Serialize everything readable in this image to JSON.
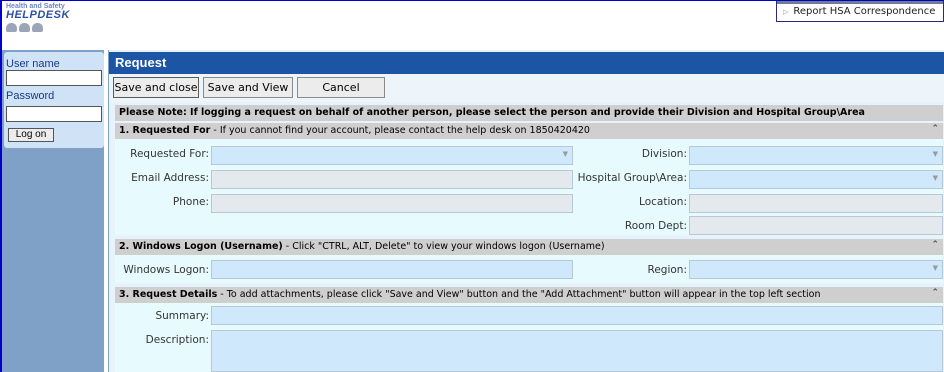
{
  "header": {
    "logo_line1": "Health and Safety",
    "logo_line2": "HELPDESK",
    "popup_item": "Report HSA Correspondence"
  },
  "login": {
    "username_label": "User name",
    "password_label": "Password",
    "username_value": "",
    "password_value": "",
    "logon_label": "Log on"
  },
  "request": {
    "title": "Request",
    "buttons": {
      "save_close": "Save and close",
      "save_view": "Save and View",
      "cancel": "Cancel"
    },
    "note": "Please Note: If logging a request on behalf of another person, please select the person and provide their Division and Hospital Group\\Area",
    "section1": {
      "heading_bold": "1. Requested For",
      "heading_rest": " - If you cannot find your account, please contact the help desk on 1850420420",
      "fields": {
        "requested_for": "Requested For:",
        "email": "Email Address:",
        "phone": "Phone:",
        "division": "Division:",
        "hospital_group": "Hospital Group\\Area:",
        "location": "Location:",
        "room_dept": "Room Dept:"
      }
    },
    "section2": {
      "heading_bold": "2. Windows Logon (Username)",
      "heading_rest": " - Click \"CTRL, ALT, Delete\" to view your windows logon (Username)",
      "fields": {
        "windows_logon": "Windows Logon:",
        "region": "Region:"
      }
    },
    "section3": {
      "heading_bold": "3. Request Details",
      "heading_rest": " - To add attachments, please click \"Save and View\" button and the \"Add Attachment\" button will appear in the top left section",
      "fields": {
        "summary": "Summary:",
        "description": "Description:"
      }
    }
  },
  "icons": {
    "collapse": "double-chevron-up-icon",
    "dropdown": "chevron-down-icon"
  },
  "colors": {
    "title_bar": "#1d55a5",
    "sidebar": "#7fa1c8",
    "field_blue": "#cfe8fb",
    "field_grey": "#e4e9ed"
  }
}
